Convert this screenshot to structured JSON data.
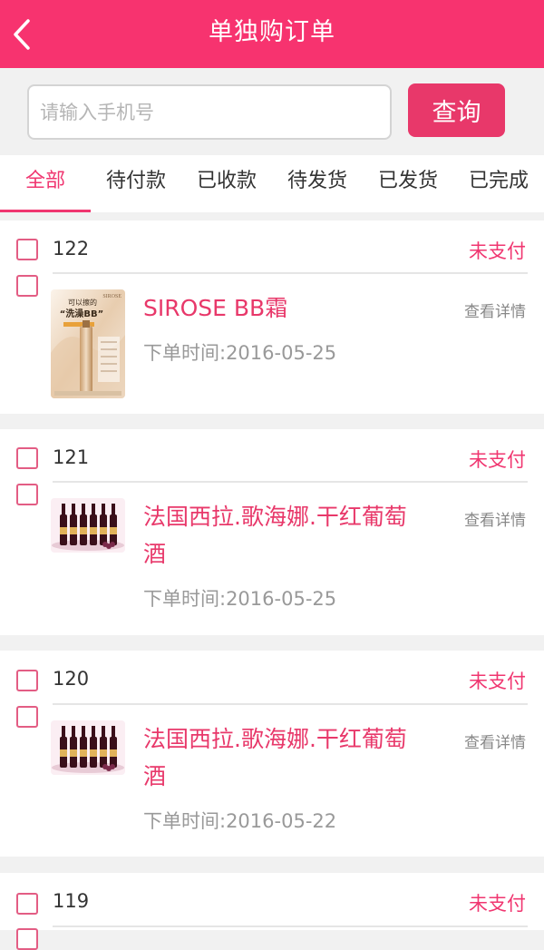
{
  "header": {
    "title": "单独购订单"
  },
  "search": {
    "placeholder": "请输入手机号",
    "button_label": "查询"
  },
  "tabs": [
    {
      "label": "全部"
    },
    {
      "label": "待付款"
    },
    {
      "label": "已收款"
    },
    {
      "label": "待发货"
    },
    {
      "label": "已发货"
    },
    {
      "label": "已完成"
    }
  ],
  "orders": [
    {
      "id": "122",
      "status": "未支付",
      "product": "SIROSE BB霜",
      "time": "下单时间:2016-05-25",
      "detail": "查看详情"
    },
    {
      "id": "121",
      "status": "未支付",
      "product": "法国西拉.歌海娜.干红葡萄酒",
      "time": "下单时间:2016-05-25",
      "detail": "查看详情"
    },
    {
      "id": "120",
      "status": "未支付",
      "product": "法国西拉.歌海娜.干红葡萄酒",
      "time": "下单时间:2016-05-22",
      "detail": "查看详情"
    },
    {
      "id": "119",
      "status": "未支付"
    }
  ],
  "product_image_text": {
    "brand": "SIROSE",
    "line1": "可以擦的",
    "line2": "“洗澡BB”"
  },
  "colors": {
    "accent": "#f7336f",
    "button": "#e8386a",
    "status": "#f03670"
  }
}
